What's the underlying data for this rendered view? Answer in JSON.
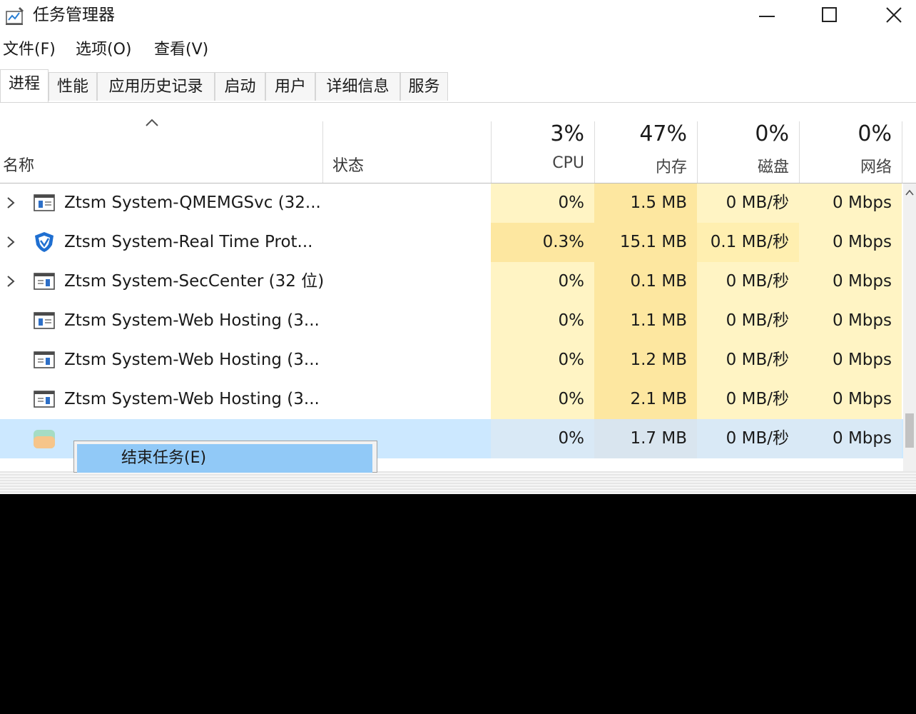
{
  "window": {
    "title": "任务管理器",
    "icon": "task-manager-icon",
    "controls": [
      "minimize-icon",
      "maximize-icon",
      "close-icon"
    ]
  },
  "menu": [
    "文件(F)",
    "选项(O)",
    "查看(V)"
  ],
  "tabs": [
    {
      "label": "进程",
      "active": true
    },
    {
      "label": "性能"
    },
    {
      "label": "应用历史记录"
    },
    {
      "label": "启动"
    },
    {
      "label": "用户"
    },
    {
      "label": "详细信息"
    },
    {
      "label": "服务"
    }
  ],
  "columns": {
    "name": "名称",
    "status": "状态",
    "cpu": {
      "percent": "3%",
      "label": "CPU"
    },
    "mem": {
      "percent": "47%",
      "label": "内存"
    },
    "disk": {
      "percent": "0%",
      "label": "磁盘"
    },
    "net": {
      "percent": "0%",
      "label": "网络"
    }
  },
  "rows": [
    {
      "expandable": true,
      "icon": "window-app-icon",
      "name": "Ztsm System-QMEMGSvc (32...",
      "cpu": "0%",
      "mem": "1.5 MB",
      "disk": "0 MB/秒",
      "net": "0 Mbps"
    },
    {
      "expandable": true,
      "icon": "shield-icon",
      "name": "Ztsm System-Real Time Prot...",
      "cpu": "0.3%",
      "mem": "15.1 MB",
      "disk": "0.1 MB/秒",
      "net": "0 Mbps"
    },
    {
      "expandable": true,
      "icon": "window-app-icon",
      "name": "Ztsm System-SecCenter (32 位)",
      "cpu": "0%",
      "mem": "0.1 MB",
      "disk": "0 MB/秒",
      "net": "0 Mbps"
    },
    {
      "expandable": false,
      "icon": "window-app-icon",
      "name": "Ztsm System-Web Hosting (3...",
      "cpu": "0%",
      "mem": "1.1 MB",
      "disk": "0 MB/秒",
      "net": "0 Mbps"
    },
    {
      "expandable": false,
      "icon": "window-app-icon",
      "name": "Ztsm System-Web Hosting (3...",
      "cpu": "0%",
      "mem": "1.2 MB",
      "disk": "0 MB/秒",
      "net": "0 Mbps"
    },
    {
      "expandable": false,
      "icon": "window-app-icon",
      "name": "Ztsm System-Web Hosting (3...",
      "cpu": "0%",
      "mem": "2.1 MB",
      "disk": "0 MB/秒",
      "net": "0 Mbps"
    },
    {
      "expandable": false,
      "icon": "colorful-app-icon",
      "name": "",
      "cpu": "0%",
      "mem": "1.7 MB",
      "disk": "0 MB/秒",
      "net": "0 Mbps",
      "selected": true
    }
  ],
  "context_menu": {
    "items": [
      "结束任务(E)"
    ]
  },
  "colors": {
    "selected_row": "#cce8ff",
    "heat_low": "#fff4c4",
    "heat_mid": "#ffefb0",
    "heat_high": "#fde7a0",
    "context_highlight": "#91c9f7"
  }
}
